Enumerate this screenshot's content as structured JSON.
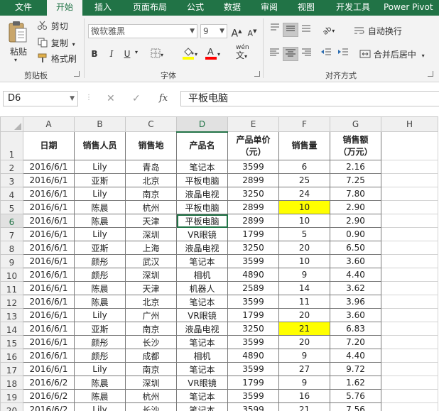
{
  "ribbon_tabs": [
    "文件",
    "开始",
    "插入",
    "页面布局",
    "公式",
    "数据",
    "审阅",
    "视图",
    "开发工具",
    "Power Pivot"
  ],
  "active_tab": "开始",
  "clipboard": {
    "paste": "粘贴",
    "cut": "剪切",
    "copy": "复制",
    "format_painter": "格式刷",
    "group": "剪贴板"
  },
  "font": {
    "name": "微软雅黑",
    "size": "9",
    "group": "字体",
    "bold": "B",
    "italic": "I",
    "underline": "U",
    "grow": "A",
    "shrink": "A",
    "phonetic": "wén"
  },
  "alignment": {
    "wrap": "自动换行",
    "merge": "合并后居中",
    "group": "对齐方式"
  },
  "colors": {
    "accent": "#217346",
    "highlight": "#ffff00",
    "fill_bar": "#ffff00",
    "font_bar": "#ff0000"
  },
  "formula_bar": {
    "name_box": "D6",
    "cancel": "✕",
    "enter": "✓",
    "fx": "fx",
    "content": "平板电脑"
  },
  "columns": [
    "A",
    "B",
    "C",
    "D",
    "E",
    "F",
    "G",
    "H"
  ],
  "selected_column": "D",
  "selected_row": "6",
  "header_cells": [
    "日期",
    "销售人员",
    "销售地",
    "产品名",
    "产品单价\n（元）",
    "销售量",
    "销售额\n（万元）"
  ],
  "rows": [
    {
      "n": "2",
      "cells": [
        "2016/6/1",
        "Lily",
        "青岛",
        "笔记本",
        "3599",
        "6",
        "2.16"
      ]
    },
    {
      "n": "3",
      "cells": [
        "2016/6/1",
        "亚斯",
        "北京",
        "平板电脑",
        "2899",
        "25",
        "7.25"
      ]
    },
    {
      "n": "4",
      "cells": [
        "2016/6/1",
        "Lily",
        "南京",
        "液晶电视",
        "3250",
        "24",
        "7.80"
      ]
    },
    {
      "n": "5",
      "cells": [
        "2016/6/1",
        "陈晨",
        "杭州",
        "平板电脑",
        "2899",
        "10",
        "2.90"
      ],
      "hl": 5
    },
    {
      "n": "6",
      "cells": [
        "2016/6/1",
        "陈晨",
        "天津",
        "平板电脑",
        "2899",
        "10",
        "2.90"
      ]
    },
    {
      "n": "7",
      "cells": [
        "2016/6/1",
        "Lily",
        "深圳",
        "VR眼镜",
        "1799",
        "5",
        "0.90"
      ]
    },
    {
      "n": "8",
      "cells": [
        "2016/6/1",
        "亚斯",
        "上海",
        "液晶电视",
        "3250",
        "20",
        "6.50"
      ]
    },
    {
      "n": "9",
      "cells": [
        "2016/6/1",
        "颜彤",
        "武汉",
        "笔记本",
        "3599",
        "10",
        "3.60"
      ]
    },
    {
      "n": "10",
      "cells": [
        "2016/6/1",
        "颜彤",
        "深圳",
        "相机",
        "4890",
        "9",
        "4.40"
      ]
    },
    {
      "n": "11",
      "cells": [
        "2016/6/1",
        "陈晨",
        "天津",
        "机器人",
        "2589",
        "14",
        "3.62"
      ]
    },
    {
      "n": "12",
      "cells": [
        "2016/6/1",
        "陈晨",
        "北京",
        "笔记本",
        "3599",
        "11",
        "3.96"
      ]
    },
    {
      "n": "13",
      "cells": [
        "2016/6/1",
        "Lily",
        "广州",
        "VR眼镜",
        "1799",
        "20",
        "3.60"
      ]
    },
    {
      "n": "14",
      "cells": [
        "2016/6/1",
        "亚斯",
        "南京",
        "液晶电视",
        "3250",
        "21",
        "6.83"
      ],
      "hl": 5
    },
    {
      "n": "15",
      "cells": [
        "2016/6/1",
        "颜彤",
        "长沙",
        "笔记本",
        "3599",
        "20",
        "7.20"
      ]
    },
    {
      "n": "16",
      "cells": [
        "2016/6/1",
        "颜彤",
        "成都",
        "相机",
        "4890",
        "9",
        "4.40"
      ]
    },
    {
      "n": "17",
      "cells": [
        "2016/6/1",
        "Lily",
        "南京",
        "笔记本",
        "3599",
        "27",
        "9.72"
      ]
    },
    {
      "n": "18",
      "cells": [
        "2016/6/2",
        "陈晨",
        "深圳",
        "VR眼镜",
        "1799",
        "9",
        "1.62"
      ]
    },
    {
      "n": "19",
      "cells": [
        "2016/6/2",
        "陈晨",
        "杭州",
        "笔记本",
        "3599",
        "16",
        "5.76"
      ]
    },
    {
      "n": "20",
      "cells": [
        "2016/6/2",
        "Lily",
        "长沙",
        "笔记本",
        "3599",
        "21",
        "7.56"
      ]
    }
  ]
}
